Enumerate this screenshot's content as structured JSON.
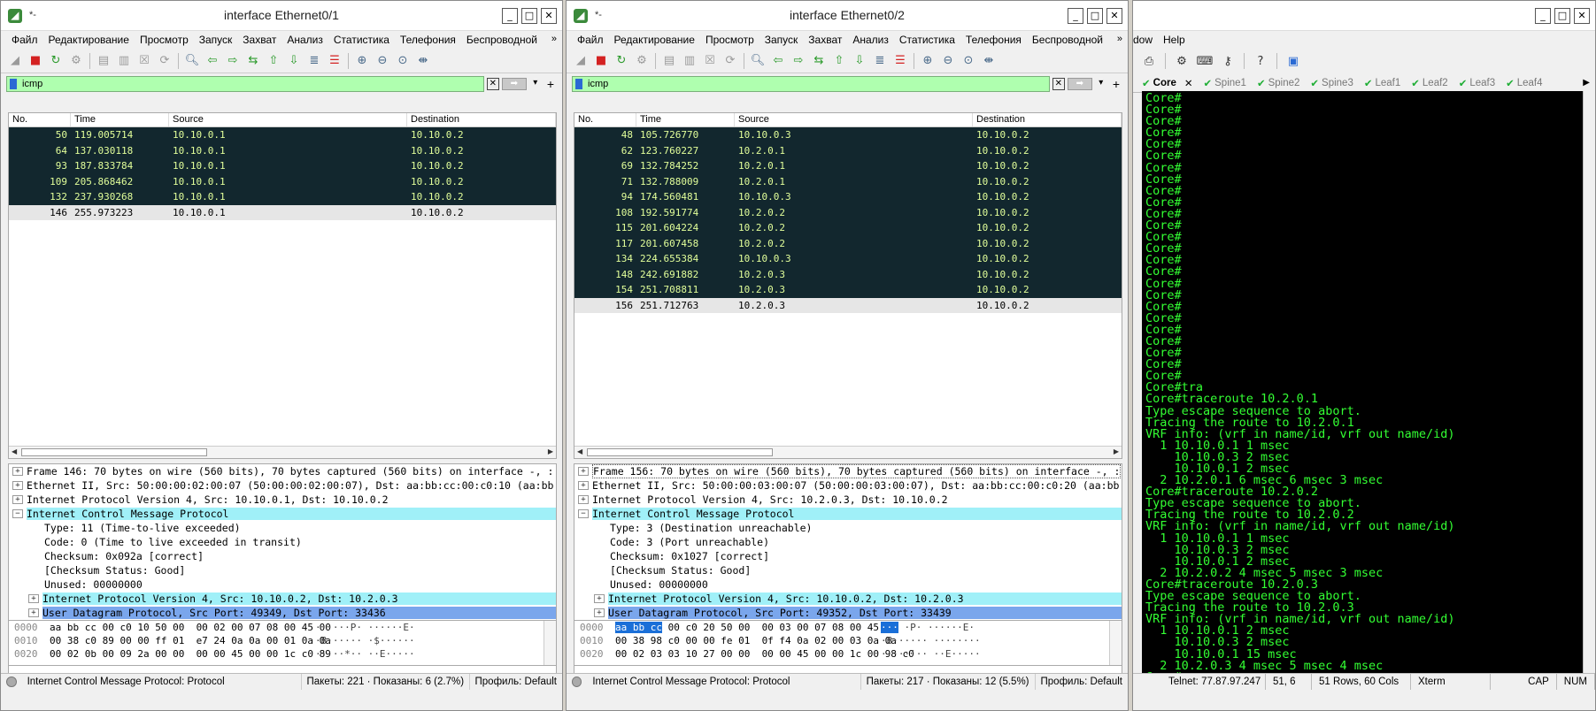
{
  "left": {
    "title_small": "*-",
    "title": "interface Ethernet0/1",
    "menu": [
      "Файл",
      "Редактирование",
      "Просмотр",
      "Запуск",
      "Захват",
      "Анализ",
      "Статистика",
      "Телефония",
      "Беспроводной"
    ],
    "filter": "icmp",
    "columns": [
      "No.",
      "Time",
      "Source",
      "Destination"
    ],
    "packets": [
      {
        "no": "50",
        "time": "119.005714",
        "src": "10.10.0.1",
        "dst": "10.10.0.2",
        "style": "dark"
      },
      {
        "no": "64",
        "time": "137.030118",
        "src": "10.10.0.1",
        "dst": "10.10.0.2",
        "style": "dark"
      },
      {
        "no": "93",
        "time": "187.833784",
        "src": "10.10.0.1",
        "dst": "10.10.0.2",
        "style": "dark"
      },
      {
        "no": "109",
        "time": "205.868462",
        "src": "10.10.0.1",
        "dst": "10.10.0.2",
        "style": "dark"
      },
      {
        "no": "132",
        "time": "237.930268",
        "src": "10.10.0.1",
        "dst": "10.10.0.2",
        "style": "dark"
      },
      {
        "no": "146",
        "time": "255.973223",
        "src": "10.10.0.1",
        "dst": "10.10.0.2",
        "style": "sel"
      }
    ],
    "details": [
      {
        "t": "Frame 146: 70 bytes on wire (560 bits), 70 bytes captured (560 bits) on interface -, :",
        "k": "l1",
        "e": "+"
      },
      {
        "t": "Ethernet II, Src: 50:00:00:02:00:07 (50:00:00:02:00:07), Dst: aa:bb:cc:00:c0:10 (aa:bb",
        "k": "l1",
        "e": "+"
      },
      {
        "t": "Internet Protocol Version 4, Src: 10.10.0.1, Dst: 10.10.0.2",
        "k": "l1",
        "e": "+"
      },
      {
        "t": "Internet Control Message Protocol",
        "k": "hdr",
        "e": "-"
      },
      {
        "t": "Type: 11 (Time-to-live exceeded)",
        "k": "l2",
        "e": ""
      },
      {
        "t": "Code: 0 (Time to live exceeded in transit)",
        "k": "l2",
        "e": ""
      },
      {
        "t": "Checksum: 0x092a [correct]",
        "k": "l2",
        "e": ""
      },
      {
        "t": "[Checksum Status: Good]",
        "k": "l2",
        "e": ""
      },
      {
        "t": "Unused: 00000000",
        "k": "l2",
        "e": ""
      },
      {
        "t": "Internet Protocol Version 4, Src: 10.10.0.2, Dst: 10.2.0.3",
        "k": "cyan",
        "e": "+"
      },
      {
        "t": "User Datagram Protocol, Src Port: 49349, Dst Port: 33436",
        "k": "blue",
        "e": "+"
      }
    ],
    "bytes": [
      {
        "off": "0000",
        "hex": "aa bb cc 00 c0 10 50 00  00 02 00 07 08 00 45 00",
        "asc": "······P· ······E·"
      },
      {
        "off": "0010",
        "hex": "00 38 c0 89 00 00 ff 01  e7 24 0a 0a 00 01 0a 0a",
        "asc": "·8······ ·$······"
      },
      {
        "off": "0020",
        "hex": "00 02 0b 00 09 2a 00 00  00 00 45 00 00 1c c0 89",
        "asc": "·····*·· ··E·····"
      }
    ],
    "status": {
      "proto": "Internet Control Message Protocol: Protocol",
      "packets": "Пакеты: 221 · Показаны: 6 (2.7%)",
      "profile": "Профиль: Default"
    }
  },
  "right": {
    "title_small": "*-",
    "title": "interface Ethernet0/2",
    "menu": [
      "Файл",
      "Редактирование",
      "Просмотр",
      "Запуск",
      "Захват",
      "Анализ",
      "Статистика",
      "Телефония",
      "Беспроводной"
    ],
    "filter": "icmp",
    "columns": [
      "No.",
      "Time",
      "Source",
      "Destination"
    ],
    "packets": [
      {
        "no": "48",
        "time": "105.726770",
        "src": "10.10.0.3",
        "dst": "10.10.0.2",
        "style": "dark"
      },
      {
        "no": "62",
        "time": "123.760227",
        "src": "10.2.0.1",
        "dst": "10.10.0.2",
        "style": "dark"
      },
      {
        "no": "69",
        "time": "132.784252",
        "src": "10.2.0.1",
        "dst": "10.10.0.2",
        "style": "dark"
      },
      {
        "no": "71",
        "time": "132.788009",
        "src": "10.2.0.1",
        "dst": "10.10.0.2",
        "style": "dark"
      },
      {
        "no": "94",
        "time": "174.560481",
        "src": "10.10.0.3",
        "dst": "10.10.0.2",
        "style": "dark"
      },
      {
        "no": "108",
        "time": "192.591774",
        "src": "10.2.0.2",
        "dst": "10.10.0.2",
        "style": "dark"
      },
      {
        "no": "115",
        "time": "201.604224",
        "src": "10.2.0.2",
        "dst": "10.10.0.2",
        "style": "dark"
      },
      {
        "no": "117",
        "time": "201.607458",
        "src": "10.2.0.2",
        "dst": "10.10.0.2",
        "style": "dark"
      },
      {
        "no": "134",
        "time": "224.655384",
        "src": "10.10.0.3",
        "dst": "10.10.0.2",
        "style": "dark"
      },
      {
        "no": "148",
        "time": "242.691882",
        "src": "10.2.0.3",
        "dst": "10.10.0.2",
        "style": "dark"
      },
      {
        "no": "154",
        "time": "251.708811",
        "src": "10.2.0.3",
        "dst": "10.10.0.2",
        "style": "dark"
      },
      {
        "no": "156",
        "time": "251.712763",
        "src": "10.2.0.3",
        "dst": "10.10.0.2",
        "style": "sel"
      }
    ],
    "details": [
      {
        "t": "Frame 156: 70 bytes on wire (560 bits), 70 bytes captured (560 bits) on interface -, :",
        "k": "l1 first",
        "e": "+"
      },
      {
        "t": "Ethernet II, Src: 50:00:00:03:00:07 (50:00:00:03:00:07), Dst: aa:bb:cc:00:c0:20 (aa:bb",
        "k": "l1",
        "e": "+"
      },
      {
        "t": "Internet Protocol Version 4, Src: 10.2.0.3, Dst: 10.10.0.2",
        "k": "l1",
        "e": "+"
      },
      {
        "t": "Internet Control Message Protocol",
        "k": "hdr",
        "e": "-"
      },
      {
        "t": "Type: 3 (Destination unreachable)",
        "k": "l2",
        "e": ""
      },
      {
        "t": "Code: 3 (Port unreachable)",
        "k": "l2",
        "e": ""
      },
      {
        "t": "Checksum: 0x1027 [correct]",
        "k": "l2",
        "e": ""
      },
      {
        "t": "[Checksum Status: Good]",
        "k": "l2",
        "e": ""
      },
      {
        "t": "Unused: 00000000",
        "k": "l2",
        "e": ""
      },
      {
        "t": "Internet Protocol Version 4, Src: 10.10.0.2, Dst: 10.2.0.3",
        "k": "cyan",
        "e": "+"
      },
      {
        "t": "User Datagram Protocol, Src Port: 49352, Dst Port: 33439",
        "k": "blue",
        "e": "+"
      }
    ],
    "bytes": [
      {
        "off": "0000",
        "hexhl": "aa bb cc",
        "hex": " 00 c0 20 50 00  00 03 00 07 08 00 45 00",
        "aschl": "···",
        "asc": " ·P· ······E·"
      },
      {
        "off": "0010",
        "hex": "00 38 98 c0 00 00 fe 01  0f f4 0a 02 00 03 0a 0a",
        "asc": "·8······ ········"
      },
      {
        "off": "0020",
        "hex": "00 02 03 03 10 27 00 00  00 00 45 00 00 1c 00 98 c0",
        "asc": "·····'·· ··E·····"
      }
    ],
    "status": {
      "proto": "Internet Control Message Protocol: Protocol",
      "packets": "Пакеты: 217 · Показаны: 12 (5.5%)",
      "profile": "Профиль: Default"
    }
  },
  "terminal": {
    "menu": [
      "dow",
      "Help"
    ],
    "tabs": [
      {
        "label": "Core",
        "active": true
      },
      {
        "label": "Spine1",
        "active": false
      },
      {
        "label": "Spine2",
        "active": false
      },
      {
        "label": "Spine3",
        "active": false
      },
      {
        "label": "Leaf1",
        "active": false
      },
      {
        "label": "Leaf2",
        "active": false
      },
      {
        "label": "Leaf3",
        "active": false
      },
      {
        "label": "Leaf4",
        "active": false
      }
    ],
    "lines": [
      "Core#",
      "Core#",
      "Core#",
      "Core#",
      "Core#",
      "Core#",
      "Core#",
      "Core#",
      "Core#",
      "Core#",
      "Core#",
      "Core#",
      "Core#",
      "Core#",
      "Core#",
      "Core#",
      "Core#",
      "Core#",
      "Core#",
      "Core#",
      "Core#",
      "Core#",
      "Core#",
      "Core#",
      "Core#",
      "Core#tra",
      "Core#traceroute 10.2.0.1",
      "Type escape sequence to abort.",
      "Tracing the route to 10.2.0.1",
      "VRF info: (vrf in name/id, vrf out name/id)",
      "  1 10.10.0.1 1 msec",
      "    10.10.0.3 2 msec",
      "    10.10.0.1 2 msec",
      "  2 10.2.0.1 6 msec 6 msec 3 msec",
      "Core#traceroute 10.2.0.2",
      "Type escape sequence to abort.",
      "Tracing the route to 10.2.0.2",
      "VRF info: (vrf in name/id, vrf out name/id)",
      "  1 10.10.0.1 1 msec",
      "    10.10.0.3 2 msec",
      "    10.10.0.1 2 msec",
      "  2 10.2.0.2 4 msec 5 msec 3 msec",
      "Core#traceroute 10.2.0.3",
      "Type escape sequence to abort.",
      "Tracing the route to 10.2.0.3",
      "VRF info: (vrf in name/id, vrf out name/id)",
      "  1 10.10.0.1 2 msec",
      "    10.10.0.3 2 msec",
      "    10.10.0.1 15 msec",
      "  2 10.2.0.3 4 msec 5 msec 4 msec",
      "Core#"
    ],
    "status": {
      "conn": "Telnet: 77.87.97.247",
      "pos": "51,  6",
      "size": "51 Rows, 60 Cols",
      "type": "Xterm",
      "cap": "CAP",
      "num": "NUM"
    }
  },
  "colors": {
    "filter_bg": "#afffaf",
    "packet_dark": "#12272e",
    "packet_text": "#e2ff9a",
    "term_fg": "#33ff33",
    "tab_check": "#1fae35"
  }
}
